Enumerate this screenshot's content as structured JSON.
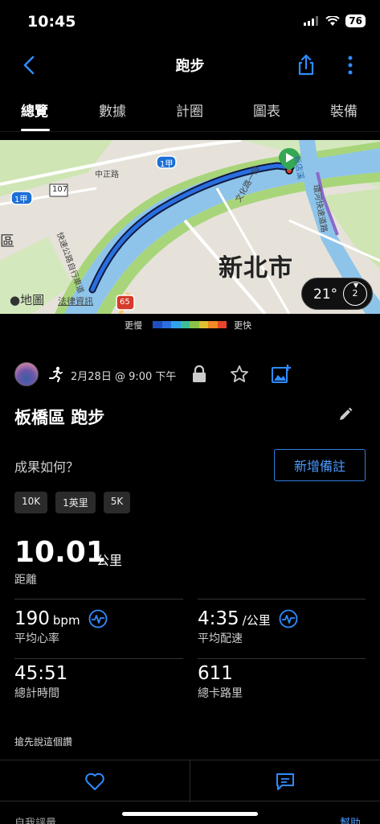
{
  "status_bar": {
    "time": "10:45",
    "battery": "76"
  },
  "nav": {
    "title": "跑步"
  },
  "tabs": [
    "總覽",
    "數據",
    "計圈",
    "圖表",
    "裝備"
  ],
  "map": {
    "city_label": "新北市",
    "district_partial": "區",
    "watermark": "地圖",
    "legal": "法律資訊",
    "weather_temp": "21°",
    "wind_speed": "2",
    "road_labels": [
      "中正路",
      "107",
      "1甲",
      "1甲",
      "65",
      "文化路一段",
      "環河快速道路",
      "新店溪",
      "快速公路自行車道"
    ]
  },
  "pace_legend": {
    "slow_label": "更慢",
    "fast_label": "更快",
    "colors": [
      "#1f4fbf",
      "#2a6fe0",
      "#2fa2e8",
      "#3cbf9a",
      "#8bc34a",
      "#e0c030",
      "#f08a24",
      "#e8452a"
    ]
  },
  "activity": {
    "date": "2月28日 @ 9:00 下午",
    "title": "板橋區 跑步",
    "how_prompt": "成果如何？",
    "add_note_label": "新增備註",
    "pills": [
      "10K",
      "1英里",
      "5K"
    ]
  },
  "stats": {
    "distance": {
      "value": "10.01",
      "unit": "公里",
      "label": "距離"
    },
    "avg_hr": {
      "value": "190",
      "unit": "bpm",
      "label": "平均心率"
    },
    "avg_pace": {
      "value": "4:35",
      "unit": "/公里",
      "label": "平均配速"
    },
    "total_time": {
      "value": "45:51",
      "label": "總計時間"
    },
    "calories": {
      "value": "611",
      "label": "總卡路里"
    }
  },
  "social": {
    "comment_hint": "搶先說這個讚"
  },
  "bottom_peek": {
    "left": "自我評量",
    "right": "幫助"
  },
  "colors": {
    "accent": "#2f7de1",
    "background": "#000000",
    "route": "#2a6fe0"
  }
}
